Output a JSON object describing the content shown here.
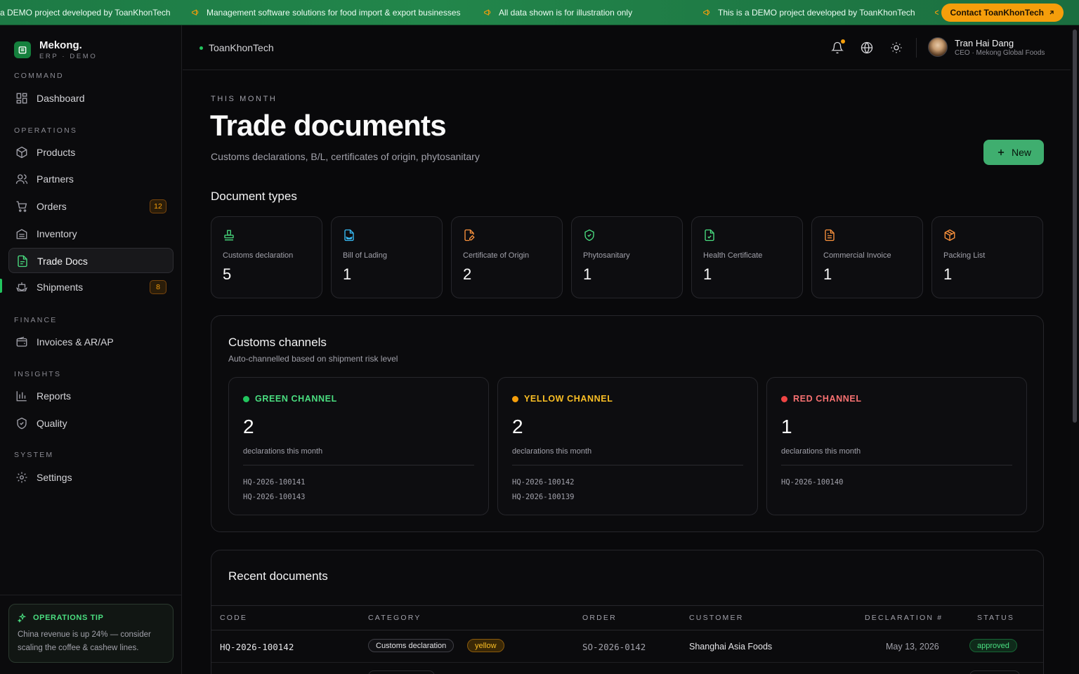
{
  "ticker": {
    "items": [
      "a DEMO project developed by ToanKhonTech",
      "Management software solutions for food import & export businesses",
      "All data shown is for illustration only",
      "This is a DEMO project developed by ToanKhonTech"
    ],
    "contact_label": "Contact ToanKhonTech"
  },
  "brand": {
    "name": "Mekong.",
    "sub": "ERP · DEMO"
  },
  "sidebar": {
    "sections": {
      "command": "COMMAND",
      "operations": "OPERATIONS",
      "finance": "FINANCE",
      "insights": "INSIGHTS",
      "system": "SYSTEM"
    },
    "items": {
      "dashboard": "Dashboard",
      "products": "Products",
      "partners": "Partners",
      "orders": "Orders",
      "orders_badge": "12",
      "inventory": "Inventory",
      "trade_docs": "Trade Docs",
      "shipments": "Shipments",
      "shipments_badge": "8",
      "invoices": "Invoices & AR/AP",
      "reports": "Reports",
      "quality": "Quality",
      "settings": "Settings"
    },
    "tip": {
      "title": "OPERATIONS TIP",
      "text": "China revenue is up 24% — consider scaling the coffee & cashew lines."
    }
  },
  "header": {
    "org": "ToanKhonTech",
    "user_name": "Tran Hai Dang",
    "user_role": "CEO · Mekong Global Foods"
  },
  "page": {
    "eyebrow": "THIS MONTH",
    "title": "Trade documents",
    "subtitle": "Customs declarations, B/L, certificates of origin, phytosanitary",
    "new_label": "New",
    "types_title": "Document types"
  },
  "doc_types": [
    {
      "label": "Customs declaration",
      "value": "5",
      "icon": "stamp-icon",
      "color": "#4ade80"
    },
    {
      "label": "Bill of Lading",
      "value": "1",
      "icon": "file-ship-icon",
      "color": "#38bdf8"
    },
    {
      "label": "Certificate of Origin",
      "value": "2",
      "icon": "file-pen-icon",
      "color": "#fb923c"
    },
    {
      "label": "Phytosanitary",
      "value": "1",
      "icon": "shield-check-icon",
      "color": "#4ade80"
    },
    {
      "label": "Health Certificate",
      "value": "1",
      "icon": "file-check-icon",
      "color": "#4ade80"
    },
    {
      "label": "Commercial Invoice",
      "value": "1",
      "icon": "file-text-icon",
      "color": "#fb923c"
    },
    {
      "label": "Packing List",
      "value": "1",
      "icon": "package-icon",
      "color": "#fb923c"
    }
  ],
  "channels": {
    "title": "Customs channels",
    "subtitle": "Auto-channelled based on shipment risk level",
    "note": "declarations this month",
    "items": [
      {
        "name": "GREEN CHANNEL",
        "count": "2",
        "color": "#4ade80",
        "dot": "#22c55e",
        "codes": [
          "HQ-2026-100141",
          "HQ-2026-100143"
        ]
      },
      {
        "name": "YELLOW CHANNEL",
        "count": "2",
        "color": "#fbbf24",
        "dot": "#f59e0b",
        "codes": [
          "HQ-2026-100142",
          "HQ-2026-100139"
        ]
      },
      {
        "name": "RED CHANNEL",
        "count": "1",
        "color": "#f87171",
        "dot": "#ef4444",
        "codes": [
          "HQ-2026-100140"
        ]
      }
    ]
  },
  "recent": {
    "title": "Recent documents",
    "columns": [
      "CODE",
      "CATEGORY",
      "ORDER",
      "CUSTOMER",
      "DECLARATION #",
      "STATUS"
    ],
    "rows": [
      {
        "code": "HQ-2026-100142",
        "category": "Customs declaration",
        "channel": "yellow",
        "order": "SO-2026-0142",
        "customer": "Shanghai Asia Foods",
        "declaration": "May 13, 2026",
        "status": "approved"
      }
    ]
  }
}
